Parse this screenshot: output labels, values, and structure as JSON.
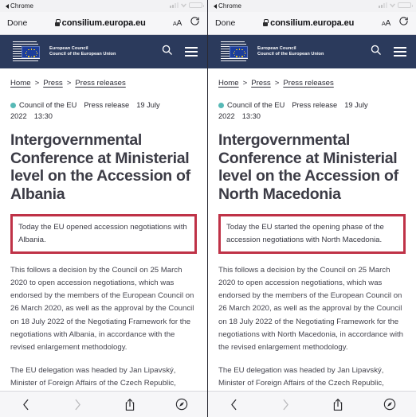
{
  "status_bar": {
    "back_app_label": "Chrome",
    "back_icon": "triangle-left-icon",
    "signal_icon": "cellular-signal-icon",
    "wifi_icon": "wifi-icon",
    "battery_icon": "battery-icon"
  },
  "url_bar": {
    "done_label": "Done",
    "lock_icon": "lock-icon",
    "url": "consilium.europa.eu",
    "text_size_label_big": "A",
    "text_size_label_small": "A",
    "reload_icon": "reload-icon"
  },
  "site_header": {
    "logo_line1": "European Council",
    "logo_line2": "Council of the European Union",
    "logo_icon": "council-of-the-eu-logo",
    "flag_icon": "eu-flag-icon",
    "search_icon": "search-icon",
    "menu_icon": "hamburger-menu-icon",
    "background_color": "#2b3a5c"
  },
  "breadcrumb": {
    "items": [
      "Home",
      "Press",
      "Press releases"
    ],
    "separator": ">"
  },
  "article_meta": {
    "source": "Council of the EU",
    "type": "Press release",
    "date": "19 July 2022",
    "time": "13:30",
    "dot_color": "#57b9b6"
  },
  "highlight": {
    "border_color": "#bf3247"
  },
  "toolbar": {
    "back_icon": "chevron-left-icon",
    "forward_icon": "chevron-right-icon",
    "share_icon": "share-icon",
    "tabs_icon": "safari-compass-icon"
  },
  "panels": [
    {
      "headline": "Intergovernmental Conference at Ministerial level on the Accession of Albania",
      "highlight_text": "Today the EU opened accession negotiations with Albania.",
      "paragraph_1": "This follows a decision by the Council on 25 March 2020 to open accession negotiations, which was endorsed by the members of the European Council on 26 March 2020, as well as the approval by the Council on 18 July 2022 of the Negotiating Framework for the negotiations with Albania, in accordance with the revised enlargement methodology.",
      "paragraph_2": "The EU delegation was headed by Jan Lipavský, Minister of Foreign Affairs of the Czech Republic,"
    },
    {
      "headline": "Intergovernmental Conference at Ministerial level on the Accession of North Macedonia",
      "highlight_text": "Today the EU started the opening phase of the accession negotiations with North Macedonia.",
      "paragraph_1": "This follows a decision by the Council on 25 March 2020 to open accession negotiations, which was endorsed by the members of the European Council on 26 March 2020, as well as the approval by the Council on 18 July 2022 of the Negotiating Framework for the negotiations with North Macedonia, in accordance with the revised enlargement methodology.",
      "paragraph_2": "The EU delegation was headed by Jan Lipavský, Minister of Foreign Affairs of the Czech Republic,"
    }
  ]
}
